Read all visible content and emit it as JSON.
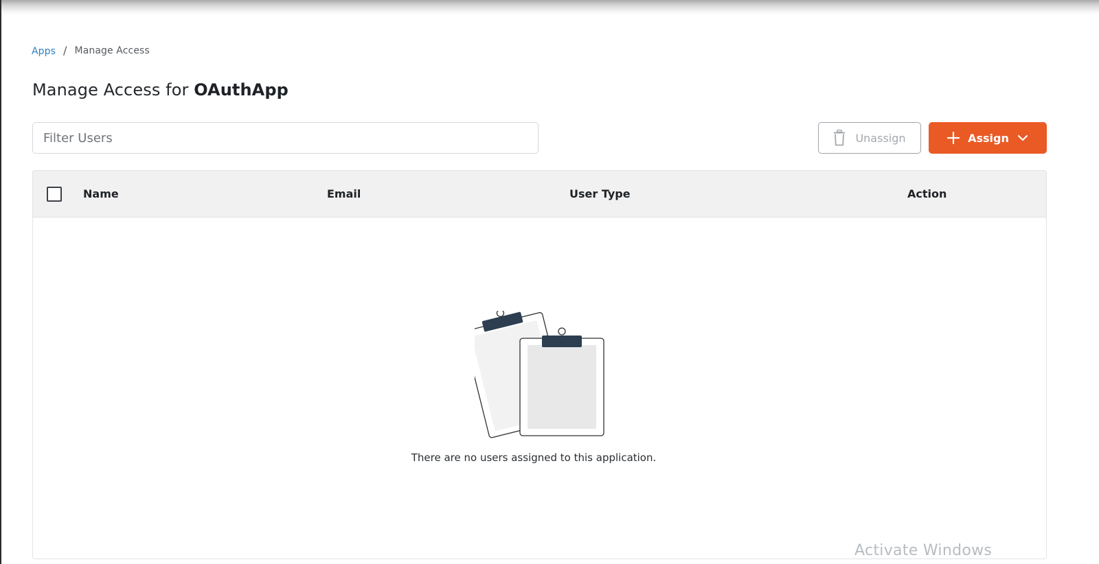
{
  "breadcrumb": {
    "root": "Apps",
    "separator": "/",
    "current": "Manage Access"
  },
  "title": {
    "prefix": "Manage Access for",
    "app_name": "OAuthApp"
  },
  "filter": {
    "placeholder": "Filter Users",
    "value": ""
  },
  "toolbar": {
    "unassign_label": "Unassign",
    "unassign_icon": "trash-icon",
    "assign_label": "Assign",
    "assign_icon": "plus-icon",
    "assign_dropdown_icon": "chevron-down-icon"
  },
  "table": {
    "columns": [
      "Name",
      "Email",
      "User Type",
      "Action"
    ],
    "rows": [],
    "empty_message": "There are no users assigned to this application.",
    "empty_icon": "clipboards-illustration"
  },
  "colors": {
    "link": "#2f7fbf",
    "accent": "#ea5a25",
    "header_bg": "#f1f1f1",
    "clip": "#2c3e50"
  },
  "os_watermark": "Activate Windows"
}
